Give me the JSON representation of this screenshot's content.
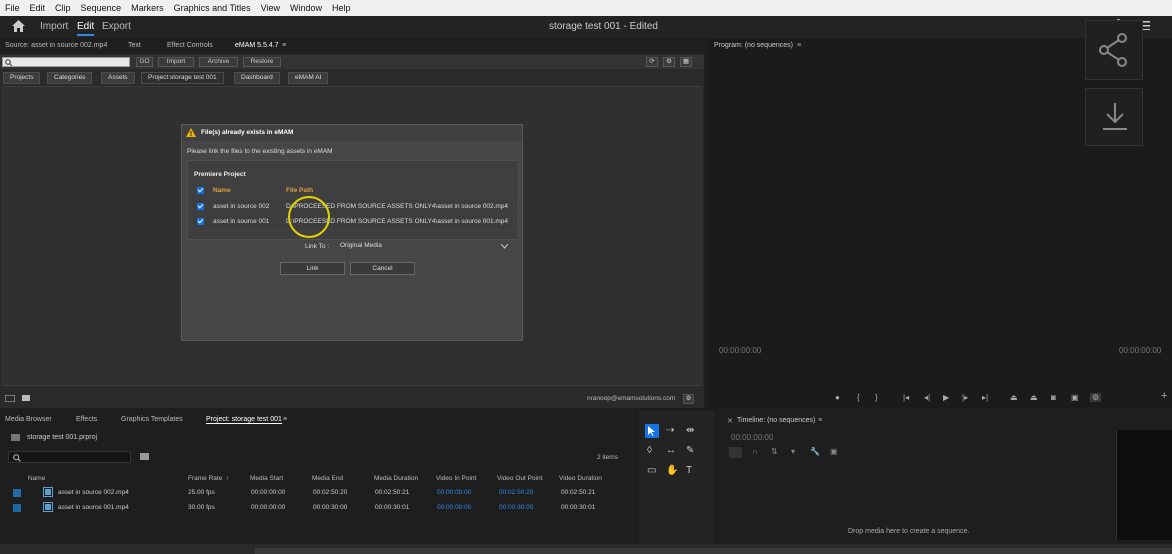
{
  "menu": [
    "File",
    "Edit",
    "Clip",
    "Sequence",
    "Markers",
    "Graphics and Titles",
    "View",
    "Window",
    "Help"
  ],
  "topbar": {
    "home_icon": "home-icon",
    "import": "Import",
    "edit": "Edit",
    "export": "Export",
    "title": "storage test 001 - Edited"
  },
  "source_panel": {
    "tabs": [
      "Source: asset in source 002.mp4",
      "Text",
      "Effect Controls",
      "eMAM 5.5.4.7"
    ],
    "buttons": {
      "go": "GO",
      "import": "Import",
      "archive": "Archive",
      "restore": "Restore"
    },
    "subtabs": [
      "Projects",
      "Categories",
      "Assets",
      "Project:storage test 001",
      "Dashboard",
      "eMAM AI"
    ],
    "footer_email": "nranoop@emamsolutions.com"
  },
  "dialog": {
    "title": "File(s) already exists in eMAM",
    "message": "Please link the files to the existing assets in eMAM",
    "section": "Premiere Project",
    "col_name": "Name",
    "col_path": "File Path",
    "rows": [
      {
        "name": "asset in source 002",
        "path": "D:\\PROCEESED FROM SOURCE ASSETS ONLY4\\asset in source 002.mp4"
      },
      {
        "name": "asset in source 001",
        "path": "D:\\PROCEESED FROM SOURCE ASSETS ONLY4\\asset in source 001.mp4"
      }
    ],
    "link_to_label": "Link To :",
    "link_to_value": "Original Media",
    "link_button": "Link",
    "cancel_button": "Cancel"
  },
  "program_panel": {
    "title": "Program: (no sequences)",
    "timecode_left": "00:00:00:00",
    "timecode_right": "00:00:00:00"
  },
  "project_panel": {
    "tabs": [
      "Media Browser",
      "Effects",
      "Graphics Templates",
      "Project: storage test 001"
    ],
    "project_file": "storage test 001.prproj",
    "items_count": "2 items",
    "columns": [
      "Name",
      "Frame Rate",
      "Media Start",
      "Media End",
      "Media Duration",
      "Video In Point",
      "Video Out Point",
      "Video Duration"
    ],
    "rows": [
      {
        "name": "asset in source 002.mp4",
        "frame_rate": "25.00 fps",
        "media_start": "00:00:00:00",
        "media_end": "00:02:50:20",
        "media_duration": "00:02:50:21",
        "in_point": "00:00:00:00",
        "out_point": "00:02:50:20",
        "video_duration": "00:02:50:21"
      },
      {
        "name": "asset in source 001.mp4",
        "frame_rate": "30.00 fps",
        "media_start": "00:00:00:00",
        "media_end": "00:00:30:00",
        "media_duration": "00:00:30:01",
        "in_point": "00:00:00:00",
        "out_point": "00:00:30:00",
        "video_duration": "00:00:30:01"
      }
    ]
  },
  "timeline_panel": {
    "title": "Timeline: (no sequences)",
    "timecode": "00:00:00:00",
    "drop_text": "Drop media here to create a sequence."
  },
  "colors": {
    "accent": "#2d8ceb",
    "checkbox": "#1473e6",
    "warning": "#e8b400",
    "orange_header": "#e0a040"
  }
}
